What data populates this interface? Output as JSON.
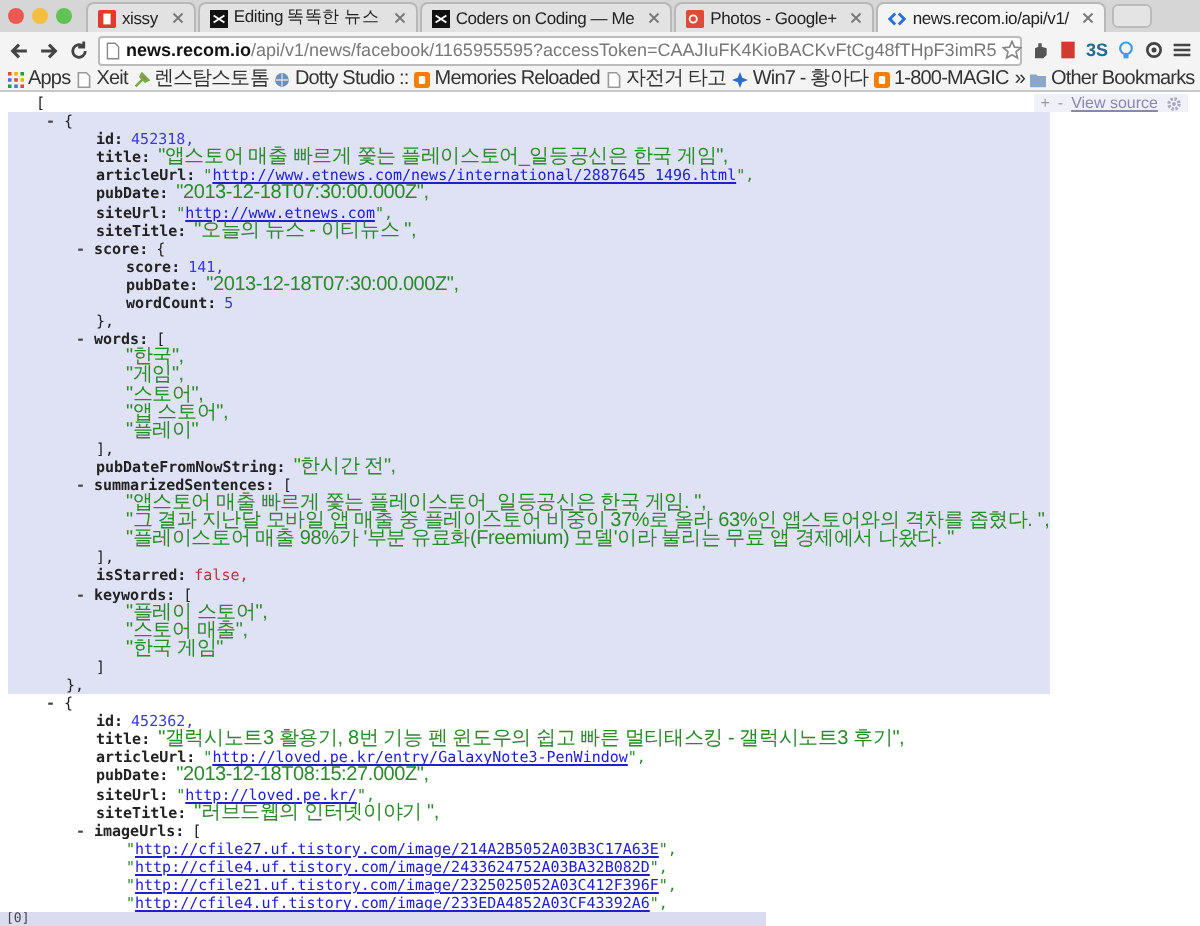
{
  "browser": {
    "tabs": [
      {
        "title": "xissy",
        "selected": false
      },
      {
        "title": "Editing 똑똑한 뉴스",
        "selected": false
      },
      {
        "title": "Coders on Coding — Me",
        "selected": false
      },
      {
        "title": "Photos - Google+",
        "selected": false
      },
      {
        "title": "news.recom.io/api/v1/",
        "selected": true
      }
    ],
    "address": {
      "host": "news.recom.io",
      "path": "/api/v1/news/facebook/1165955595?accessToken=CAAJIuFK4KioBACKvFtCg48fTHpF3imR5"
    },
    "extensions_label": "3S",
    "bookmarks": [
      {
        "title": "Apps"
      },
      {
        "title": "Xeit"
      },
      {
        "title": "렌스탐스토톰"
      },
      {
        "title": "Dotty Studio ::"
      },
      {
        "title": "Memories Reloaded"
      },
      {
        "title": "자전거 타고"
      },
      {
        "title": "Win7 - 황아다"
      },
      {
        "title": "1-800-MAGIC"
      },
      {
        "title": "»"
      },
      {
        "title": "Other Bookmarks"
      }
    ]
  },
  "viewer": {
    "expand": "+",
    "collapse": "-",
    "view_source": "View source",
    "status_path": "[0]",
    "root": {
      "kind": "container",
      "open": "[",
      "children": [
        {
          "kind": "container",
          "toggle": "-",
          "open": "{",
          "close": "},",
          "highlighted": true,
          "children": [
            {
              "kind": "number",
              "key": "id:",
              "value": "452318,"
            },
            {
              "kind": "string",
              "key": "title:",
              "value": "\"앱스토어 매출 빠르게 쫓는 플레이스토어_일등공신은 한국 게임\","
            },
            {
              "kind": "link",
              "key": "articleUrl:",
              "before": "\"",
              "url": "http://www.etnews.com/news/international/2887645_1496.html",
              "after": "\","
            },
            {
              "kind": "string",
              "key": "pubDate:",
              "value": "\"2013-12-18T07:30:00.000Z\","
            },
            {
              "kind": "link",
              "key": "siteUrl:",
              "before": "\"",
              "url": "http://www.etnews.com",
              "after": "\","
            },
            {
              "kind": "string",
              "key": "siteTitle:",
              "value": "\"오늘의 뉴스 - 이티뉴스 \","
            },
            {
              "kind": "container",
              "toggle": "-",
              "key": "score:",
              "open": "{",
              "close": "},",
              "children": [
                {
                  "kind": "number",
                  "key": "score:",
                  "value": "141,"
                },
                {
                  "kind": "string",
                  "key": "pubDate:",
                  "value": "\"2013-12-18T07:30:00.000Z\","
                },
                {
                  "kind": "number",
                  "key": "wordCount:",
                  "value": "5"
                }
              ]
            },
            {
              "kind": "container",
              "toggle": "-",
              "key": "words:",
              "open": "[",
              "close": "],",
              "children": [
                {
                  "kind": "string",
                  "value": "\"한국\","
                },
                {
                  "kind": "string",
                  "value": "\"게임\","
                },
                {
                  "kind": "string",
                  "value": "\"스토어\","
                },
                {
                  "kind": "string",
                  "value": "\"앱 스토어\","
                },
                {
                  "kind": "string",
                  "value": "\"플레이\""
                }
              ]
            },
            {
              "kind": "string",
              "key": "pubDateFromNowString:",
              "value": "\"한시간 전\","
            },
            {
              "kind": "container",
              "toggle": "-",
              "key": "summarizedSentences:",
              "open": "[",
              "close": "],",
              "children": [
                {
                  "kind": "string",
                  "value": "\"앱스토어 매출 빠르게 쫓는 플레이스토어_일등공신은 한국 게임. \","
                },
                {
                  "kind": "string",
                  "value": "\"그 결과 지난달 모바일 앱 매출 중 플레이스토어 비중이 37%로 올라 63%인 앱스토어와의 격차를 좁혔다. \","
                },
                {
                  "kind": "string",
                  "value": "\"플레이스토어 매출 98%가 '부분 유료화(Freemium) 모델'이라 불리는 무료 앱 경제에서 나왔다. \""
                }
              ]
            },
            {
              "kind": "bool",
              "key": "isStarred:",
              "value": "false,"
            },
            {
              "kind": "container",
              "toggle": "-",
              "key": "keywords:",
              "open": "[",
              "close": "]",
              "children": [
                {
                  "kind": "string",
                  "value": "\"플레이 스토어\","
                },
                {
                  "kind": "string",
                  "value": "\"스토어 매출\","
                },
                {
                  "kind": "string",
                  "value": "\"한국 게임\""
                }
              ]
            }
          ]
        },
        {
          "kind": "container",
          "toggle": "-",
          "open": "{",
          "children": [
            {
              "kind": "number",
              "key": "id:",
              "value": "452362,"
            },
            {
              "kind": "string",
              "key": "title:",
              "value": "\"갤럭시노트3 활용기, 8번 기능 펜 윈도우의 쉽고 빠른 멀티태스킹 - 갤럭시노트3 후기\","
            },
            {
              "kind": "link",
              "key": "articleUrl:",
              "before": "\"",
              "url": "http://loved.pe.kr/entry/GalaxyNote3-PenWindow",
              "after": "\","
            },
            {
              "kind": "string",
              "key": "pubDate:",
              "value": "\"2013-12-18T08:15:27.000Z\","
            },
            {
              "kind": "link",
              "key": "siteUrl:",
              "before": "\"",
              "url": "http://loved.pe.kr/",
              "after": "\","
            },
            {
              "kind": "string",
              "key": "siteTitle:",
              "value": "\"러브드웹의 인터넷이야기 \","
            },
            {
              "kind": "container",
              "toggle": "-",
              "key": "imageUrls:",
              "open": "[",
              "children": [
                {
                  "kind": "link",
                  "before": "\"",
                  "url": "http://cfile27.uf.tistory.com/image/214A2B5052A03B3C17A63E",
                  "after": "\","
                },
                {
                  "kind": "link",
                  "before": "\"",
                  "url": "http://cfile4.uf.tistory.com/image/2433624752A03BA32B082D",
                  "after": "\","
                },
                {
                  "kind": "link",
                  "before": "\"",
                  "url": "http://cfile21.uf.tistory.com/image/2325025052A03C412F396F",
                  "after": "\","
                },
                {
                  "kind": "link",
                  "before": "\"",
                  "url": "http://cfile4.uf.tistory.com/image/233EDA4852A03CF43392A6",
                  "after": "\","
                }
              ]
            }
          ]
        }
      ]
    }
  }
}
